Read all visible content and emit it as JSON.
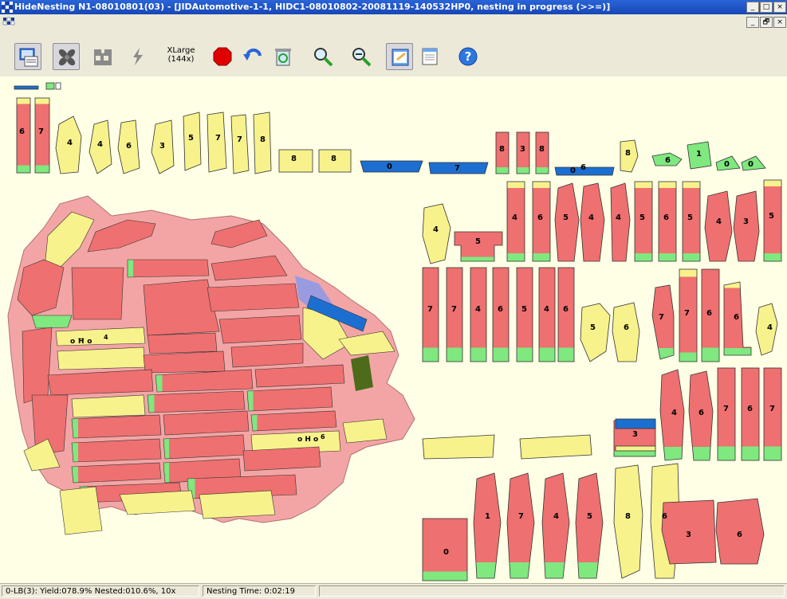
{
  "window": {
    "title": "HideNesting N1-08010801(03) - [JIDAutomotive-1-1, HIDC1-08010802-20081119-140532HP0, nesting in progress (>>=)]",
    "controls": [
      "_",
      "□",
      "×"
    ],
    "doc_controls": [
      "_",
      "🗗",
      "×"
    ]
  },
  "toolbar": {
    "buttons": [
      {
        "name": "open-nest-button",
        "icon": "monitor-icon",
        "pressed": true
      },
      {
        "name": "fan-button",
        "icon": "fan-icon",
        "pressed": true
      },
      {
        "name": "puzzle-button",
        "icon": "puzzle-icon",
        "pressed": false
      },
      {
        "name": "lightning-button",
        "icon": "lightning-icon",
        "pressed": false
      },
      {
        "name": "stop-button",
        "icon": "stop-icon",
        "pressed": false
      },
      {
        "name": "undo-button",
        "icon": "undo-icon",
        "pressed": false
      },
      {
        "name": "recycle-button",
        "icon": "recycle-icon",
        "pressed": false
      },
      {
        "name": "zoom-in-button",
        "icon": "zoom-in-icon",
        "pressed": false
      },
      {
        "name": "zoom-out-button",
        "icon": "zoom-out-icon",
        "pressed": false
      },
      {
        "name": "report-button",
        "icon": "report-icon",
        "pressed": true
      },
      {
        "name": "sheet-button",
        "icon": "sheet-icon",
        "pressed": false
      },
      {
        "name": "help-button",
        "icon": "help-icon",
        "pressed": false
      }
    ],
    "zoom_label_line1": "XLarge",
    "zoom_label_line2": "(144x)"
  },
  "colors": {
    "part_red": "#ef7070",
    "part_yellow": "#f7f28c",
    "part_green": "#7fe87f",
    "part_blue": "#1c6fd0",
    "hide_pink": "#f3a5a5",
    "canvas": "#ffffe6"
  },
  "pieces": {
    "top_row": [
      "6",
      "7",
      "4",
      "4",
      "6",
      "3",
      "5",
      "7",
      "7",
      "8",
      "8",
      "8",
      "0",
      "7",
      "8",
      "3",
      "8",
      "0",
      "6",
      "8",
      "6",
      "1",
      "0",
      "0"
    ],
    "row2": [
      "4",
      "5",
      "4",
      "6",
      "5",
      "4",
      "4",
      "5",
      "6",
      "5",
      "4",
      "3",
      "5"
    ],
    "row3": [
      "7",
      "7",
      "4",
      "6",
      "5",
      "4",
      "6",
      "5",
      "6",
      "7",
      "7",
      "6",
      "6",
      "4"
    ],
    "row4": [
      "3",
      "4",
      "6",
      "7",
      "6",
      "7"
    ],
    "row5": [
      "0",
      "1",
      "7",
      "4",
      "5",
      "8",
      "6",
      "3",
      "6"
    ],
    "hide_labels": [
      "4",
      "6"
    ]
  },
  "status": {
    "yield_text": "0-LB(3): Yield:078.9% Nested:010.6%, 10x",
    "time_text": "Nesting Time: 0:02:19"
  }
}
